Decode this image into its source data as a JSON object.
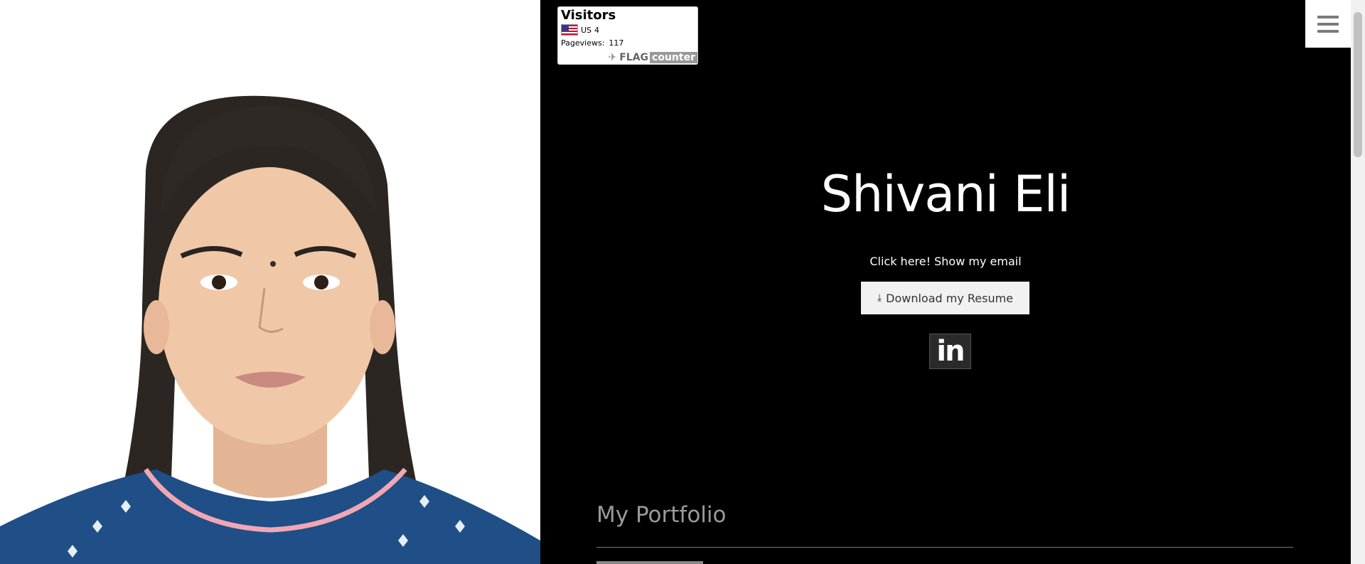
{
  "flag_counter": {
    "title": "Visitors",
    "country_code": "US",
    "country_visitors": "4",
    "pageviews_label": "Pageviews:",
    "pageviews_value": "117",
    "brand_part1": "FLAG",
    "brand_part2": "counter"
  },
  "hero": {
    "name": "Shivani Eli",
    "email_link": "Click here! Show my email",
    "resume_button": "Download my Resume",
    "linkedin_label": "in"
  },
  "portfolio": {
    "title": "My Portfolio"
  },
  "colors": {
    "background": "#000000",
    "photo_background": "#ffffff",
    "button_bg": "#f1f1f1"
  },
  "icons": {
    "menu": "hamburger-icon",
    "download": "download-icon",
    "linkedin": "linkedin-icon"
  }
}
